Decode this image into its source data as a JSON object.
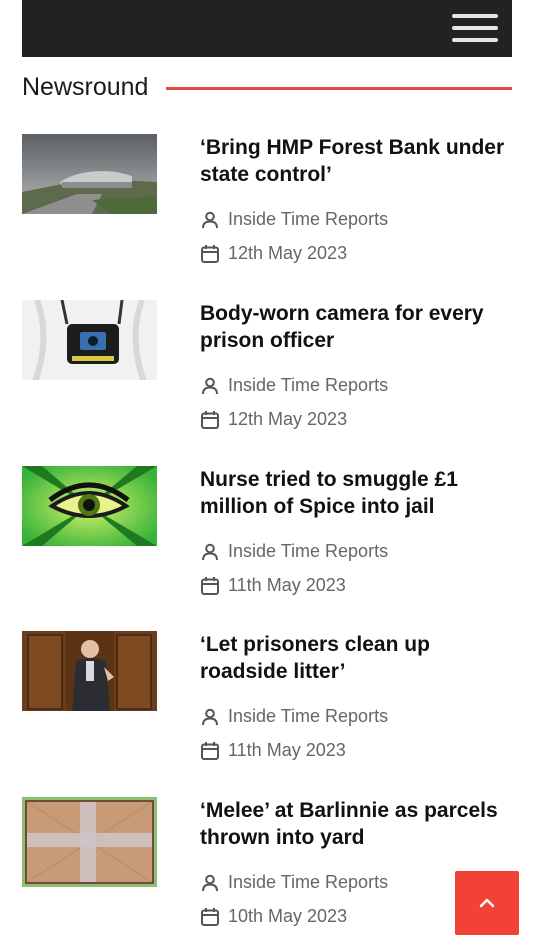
{
  "header": {
    "menu_icon": "hamburger-menu-icon"
  },
  "section": {
    "title": "Newsround",
    "accent_color": "#e8493c"
  },
  "articles": [
    {
      "headline": "‘Bring HMP Forest Bank under state control’",
      "author": "Inside Time Reports",
      "date": "12th May 2023",
      "thumbnail": "prison-building-photo"
    },
    {
      "headline": "Body-worn camera for every prison officer",
      "author": "Inside Time Reports",
      "date": "12th May 2023",
      "thumbnail": "body-camera-photo"
    },
    {
      "headline": "Nurse tried to smuggle £1 million of Spice into jail",
      "author": "Inside Time Reports",
      "date": "11th May 2023",
      "thumbnail": "eye-illustration"
    },
    {
      "headline": "‘Let prisoners clean up roadside litter’",
      "author": "Inside Time Reports",
      "date": "11th May 2023",
      "thumbnail": "man-speaking-photo"
    },
    {
      "headline": "‘Melee’ at Barlinnie as parcels thrown into yard",
      "author": "Inside Time Reports",
      "date": "10th May 2023",
      "thumbnail": "parcel-photo"
    }
  ],
  "scroll_top": {
    "icon": "chevron-up-icon",
    "color": "#f24236"
  }
}
